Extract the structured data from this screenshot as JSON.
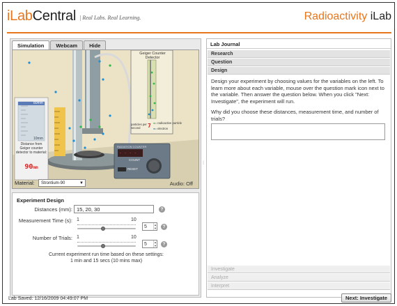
{
  "header": {
    "logo_prefix": "iLab",
    "logo_suffix": "Central",
    "tagline": "| Real Labs. Real Learning.",
    "app_title_orange": "Radioactivity",
    "app_title_dark": "iLab"
  },
  "tabs": [
    "Simulation",
    "Webcam",
    "Hide"
  ],
  "simulation": {
    "geiger_label": "Geiger Counter Detector",
    "ruler_top": "80mm",
    "ruler_bottom": "10mm",
    "distance_caption": "Distance from Geiger counter detector to material:",
    "distance_readout": "90",
    "distance_unit": "mm",
    "counter_title": "RADIATION COUNTER",
    "counter_display": "- - - -",
    "counter_label_left": "RESET",
    "counter_label_right": "COUNT",
    "legend_particles": "particles per second",
    "legend_count": "7",
    "legend_radioactive": "= radioactive particle",
    "legend_electron": "= electron",
    "material_label": "Material:",
    "material_value": "Strontium-90",
    "audio": "Audio: Off"
  },
  "experiment": {
    "title": "Experiment Design",
    "distances_label": "Distances (mm):",
    "distances_value": "15, 20, 30",
    "measurement_label": "Measurement Time (s):",
    "measurement_min": "1",
    "measurement_max": "10",
    "measurement_value": "5",
    "measurement_fraction": 0.44,
    "trials_label": "Number of Trials:",
    "trials_min": "1",
    "trials_max": "10",
    "trials_value": "5",
    "trials_fraction": 0.44,
    "runtime_line1": "Current experiment run time based on these settings:",
    "runtime_line2": "1 min and 15 secs  (10 mins max)"
  },
  "journal": {
    "title": "Lab Journal",
    "sections": [
      "Research",
      "Question",
      "Design"
    ],
    "design_text": "Design your experiment by choosing values for the variables on the left.  To learn more about each variable, mouse over the question mark icon next to the variable. Then answer the question below.  When you click \"Next: Investigate\", the experiment will run.",
    "question": "Why did you choose these distances, measurement time, and number of trials?",
    "answer": "",
    "later_sections": [
      "Investigate",
      "Analyze",
      "Interpret"
    ]
  },
  "footer": {
    "saved": "Lab Saved: 12/16/2009 04:49:07 PM",
    "next_button": "Next: Investigate"
  },
  "colors": {
    "accent": "#e8761c",
    "readout": "#e02020"
  }
}
